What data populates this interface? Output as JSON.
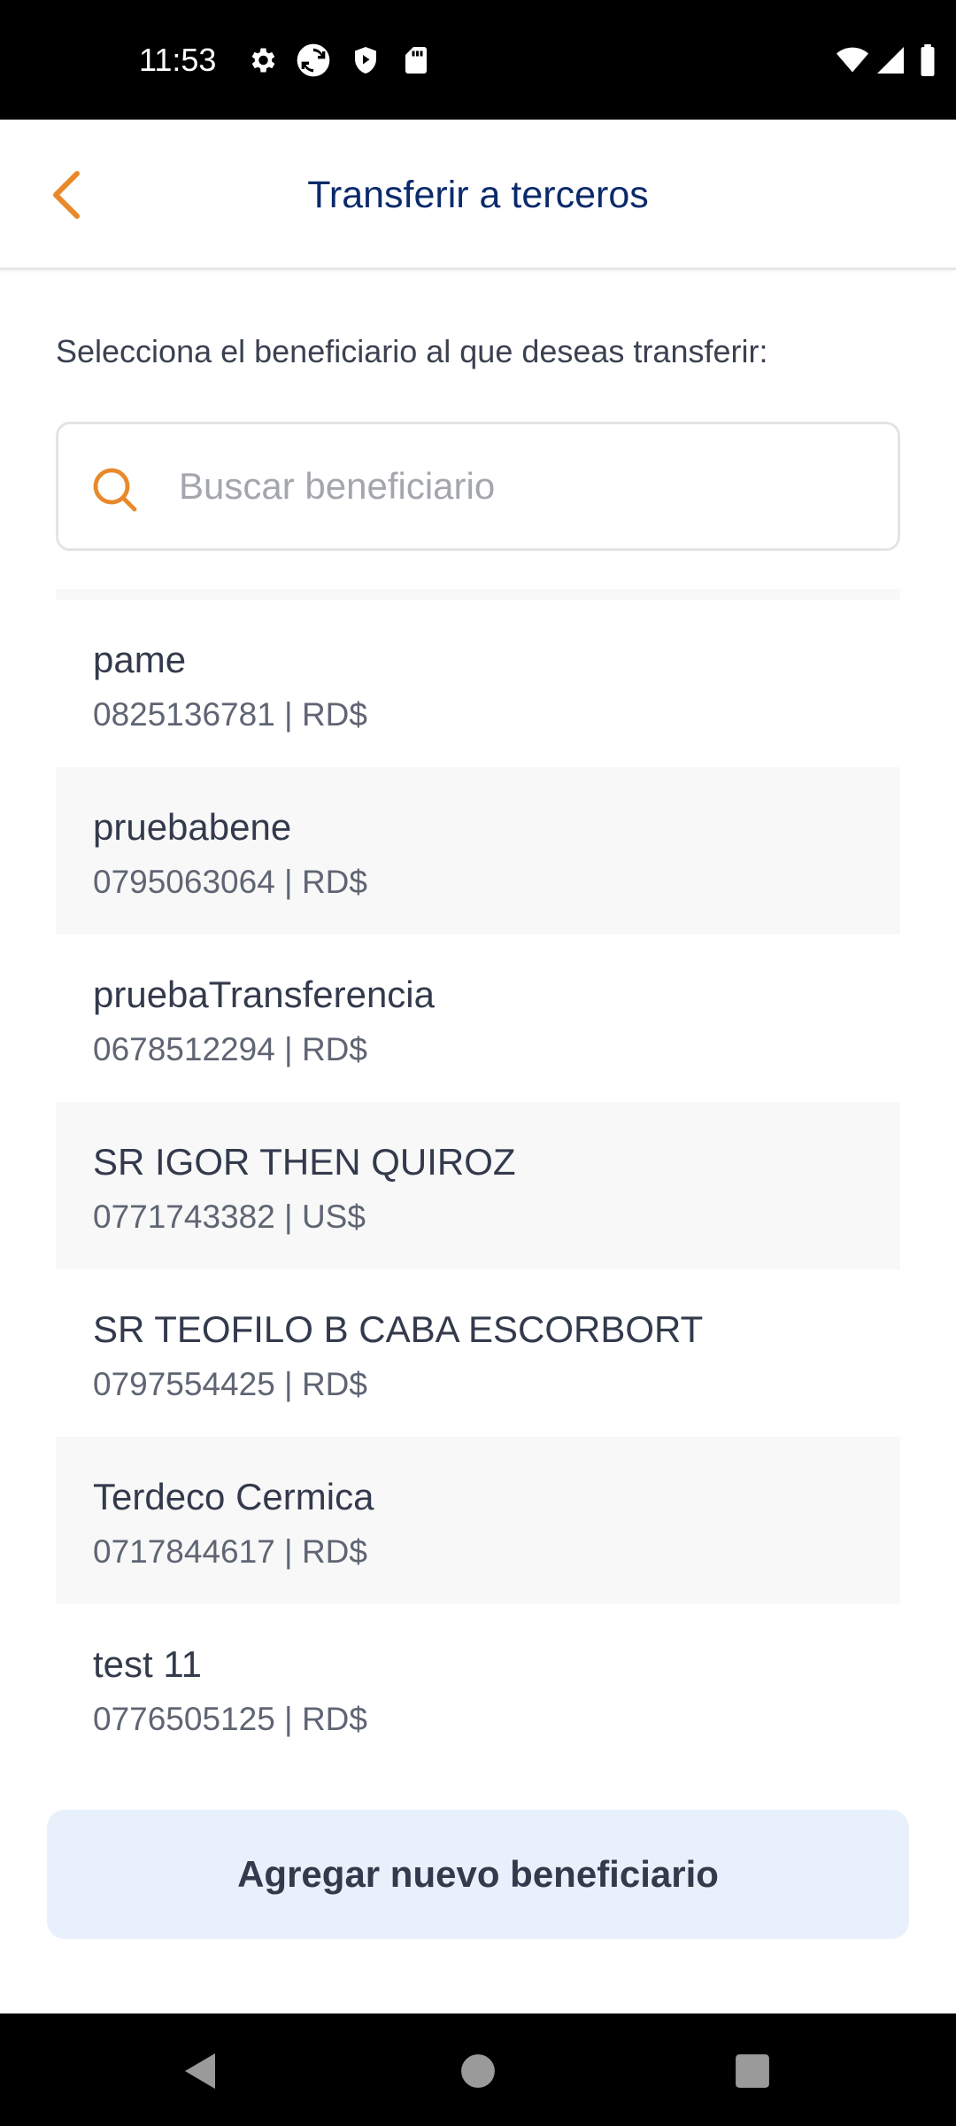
{
  "status_bar": {
    "time": "11:53",
    "left_icons": [
      "gear-icon",
      "sync-icon",
      "shield-play-icon",
      "sd-card-icon"
    ],
    "right_icons": [
      "wifi-icon",
      "signal-icon",
      "battery-icon"
    ]
  },
  "header": {
    "back_icon": "chevron-left-icon",
    "title": "Transferir a terceros"
  },
  "instruction": "Selecciona el beneficiario al que deseas transferir:",
  "search": {
    "placeholder": "Buscar beneficiario",
    "value": ""
  },
  "beneficiaries": [
    {
      "name": "pame",
      "account": "0825136781",
      "currency": "RD$"
    },
    {
      "name": "pruebabene",
      "account": "0795063064",
      "currency": "RD$"
    },
    {
      "name": "pruebaTransferencia",
      "account": "0678512294",
      "currency": "RD$"
    },
    {
      "name": "SR IGOR THEN QUIROZ",
      "account": "0771743382",
      "currency": "US$"
    },
    {
      "name": "SR TEOFILO B CABA ESCORBORT",
      "account": "0797554425",
      "currency": "RD$"
    },
    {
      "name": "Terdeco Cermica",
      "account": "0717844617",
      "currency": "RD$"
    },
    {
      "name": "test 11",
      "account": "0776505125",
      "currency": "RD$"
    }
  ],
  "add_button_label": "Agregar nuevo beneficiario",
  "nav_bar": {
    "icons": [
      "back-triangle-icon",
      "home-circle-icon",
      "recents-square-icon"
    ]
  },
  "colors": {
    "accent_orange": "#e8892a",
    "title_navy": "#0b2a6b",
    "button_bg": "#e8f1fb"
  }
}
